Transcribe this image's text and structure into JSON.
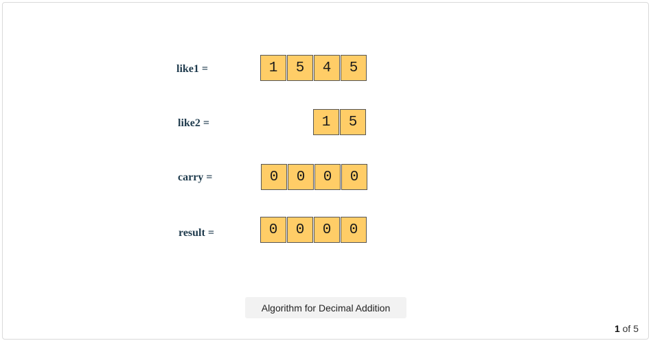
{
  "rows": [
    {
      "label": "like1 =",
      "digits": [
        "1",
        "5",
        "4",
        "5"
      ]
    },
    {
      "label": "like2 =",
      "digits": [
        "1",
        "5"
      ]
    },
    {
      "label": "carry =",
      "digits": [
        "0",
        "0",
        "0",
        "0"
      ]
    },
    {
      "label": "result =",
      "digits": [
        "0",
        "0",
        "0",
        "0"
      ]
    }
  ],
  "caption": "Algorithm for Decimal Addition",
  "pager": {
    "current": "1",
    "of_text": "of",
    "total": "5"
  }
}
